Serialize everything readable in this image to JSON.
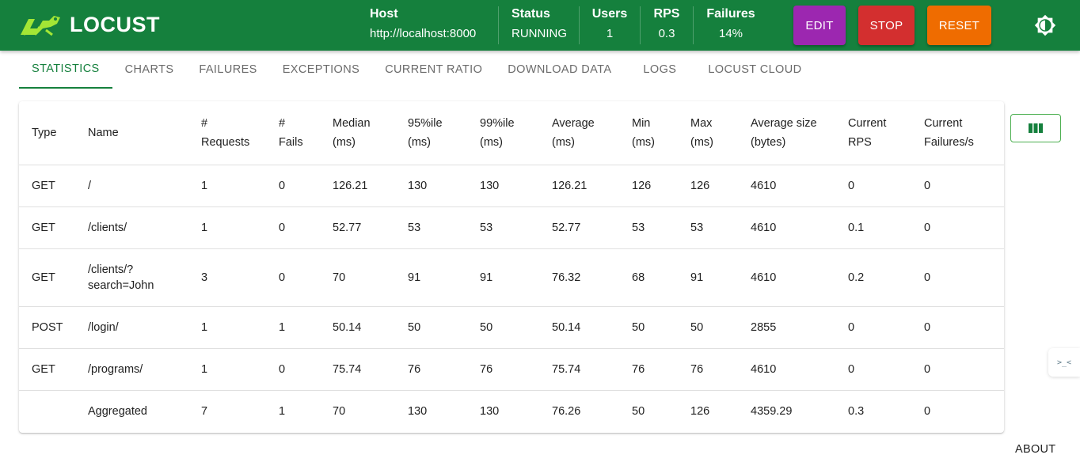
{
  "app": {
    "logo_text": "LOCUST"
  },
  "header": {
    "host": {
      "label": "Host",
      "value": "http://localhost:8000"
    },
    "status": {
      "label": "Status",
      "value": "RUNNING"
    },
    "users": {
      "label": "Users",
      "value": "1"
    },
    "rps": {
      "label": "RPS",
      "value": "0.3"
    },
    "failures": {
      "label": "Failures",
      "value": "14%"
    },
    "buttons": {
      "edit": "EDIT",
      "stop": "STOP",
      "reset": "RESET"
    },
    "theme_icon": "brightness-icon"
  },
  "tabs": [
    {
      "label": "STATISTICS",
      "active": true
    },
    {
      "label": "CHARTS"
    },
    {
      "label": "FAILURES"
    },
    {
      "label": "EXCEPTIONS"
    },
    {
      "label": "CURRENT RATIO"
    },
    {
      "label": "DOWNLOAD DATA"
    },
    {
      "label": "LOGS"
    },
    {
      "label": "LOCUST CLOUD"
    }
  ],
  "table": {
    "headers": [
      {
        "l1": "Type",
        "l2": ""
      },
      {
        "l1": "Name",
        "l2": ""
      },
      {
        "l1": "#",
        "l2": "Requests"
      },
      {
        "l1": "#",
        "l2": "Fails"
      },
      {
        "l1": "Median",
        "l2": "(ms)"
      },
      {
        "l1": "95%ile",
        "l2": "(ms)"
      },
      {
        "l1": "99%ile",
        "l2": "(ms)"
      },
      {
        "l1": "Average",
        "l2": "(ms)"
      },
      {
        "l1": "Min",
        "l2": "(ms)"
      },
      {
        "l1": "Max",
        "l2": "(ms)"
      },
      {
        "l1": "Average size",
        "l2": "(bytes)"
      },
      {
        "l1": "Current",
        "l2": "RPS"
      },
      {
        "l1": "Current",
        "l2": "Failures/s"
      }
    ],
    "rows": [
      [
        "GET",
        "/",
        "1",
        "0",
        "126.21",
        "130",
        "130",
        "126.21",
        "126",
        "126",
        "4610",
        "0",
        "0"
      ],
      [
        "GET",
        "/clients/",
        "1",
        "0",
        "52.77",
        "53",
        "53",
        "52.77",
        "53",
        "53",
        "4610",
        "0.1",
        "0"
      ],
      [
        "GET",
        "/clients/?search=John",
        "3",
        "0",
        "70",
        "91",
        "91",
        "76.32",
        "68",
        "91",
        "4610",
        "0.2",
        "0"
      ],
      [
        "POST",
        "/login/",
        "1",
        "1",
        "50.14",
        "50",
        "50",
        "50.14",
        "50",
        "50",
        "2855",
        "0",
        "0"
      ],
      [
        "GET",
        "/programs/",
        "1",
        "0",
        "75.74",
        "76",
        "76",
        "75.74",
        "76",
        "76",
        "4610",
        "0",
        "0"
      ],
      [
        "",
        "Aggregated",
        "7",
        "1",
        "70",
        "130",
        "130",
        "76.26",
        "50",
        "126",
        "4359.29",
        "0.3",
        "0"
      ]
    ]
  },
  "column_selector_icon": "view-column-icon",
  "side_widget": {
    "text": ">_<"
  },
  "footer": {
    "about": "ABOUT"
  }
}
